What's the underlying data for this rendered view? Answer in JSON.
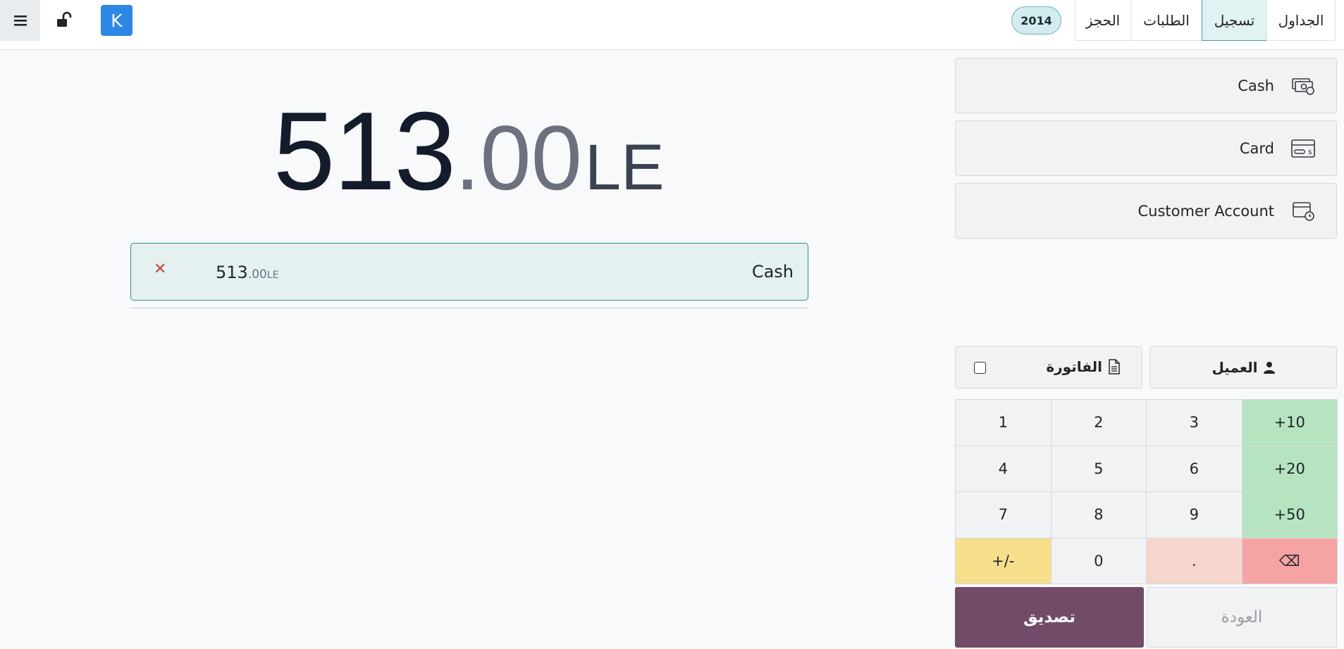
{
  "header": {
    "avatar_letter": "K",
    "order_badge": "2014",
    "tabs": [
      {
        "label": "الحجز"
      },
      {
        "label": "الطلبات"
      },
      {
        "label": "تسجيل",
        "active": true
      },
      {
        "label": "الجداول"
      }
    ]
  },
  "total": {
    "integer": "513",
    "decimal": ".00",
    "currency": "LE"
  },
  "payment_lines": [
    {
      "method": "Cash",
      "amount_int": "513",
      "amount_dec": ".00",
      "currency": "LE"
    }
  ],
  "payment_methods": [
    {
      "label": "Cash",
      "icon": "cash-icon"
    },
    {
      "label": "Card",
      "icon": "card-icon"
    },
    {
      "label": "Customer Account",
      "icon": "customer-account-icon"
    }
  ],
  "customer_button": "العميل",
  "invoice_button": "الفاتورة",
  "numpad": [
    [
      "1",
      "2",
      "3",
      "+10"
    ],
    [
      "4",
      "5",
      "6",
      "+20"
    ],
    [
      "7",
      "8",
      "9",
      "+50"
    ],
    [
      "+/-",
      "0",
      ".",
      "⌫"
    ]
  ],
  "validate_button": "تصديق",
  "back_button": "العودة",
  "colors": {
    "primary": "#714b67",
    "accent": "#2d87e7",
    "active_tab": "#e0f2f1"
  }
}
